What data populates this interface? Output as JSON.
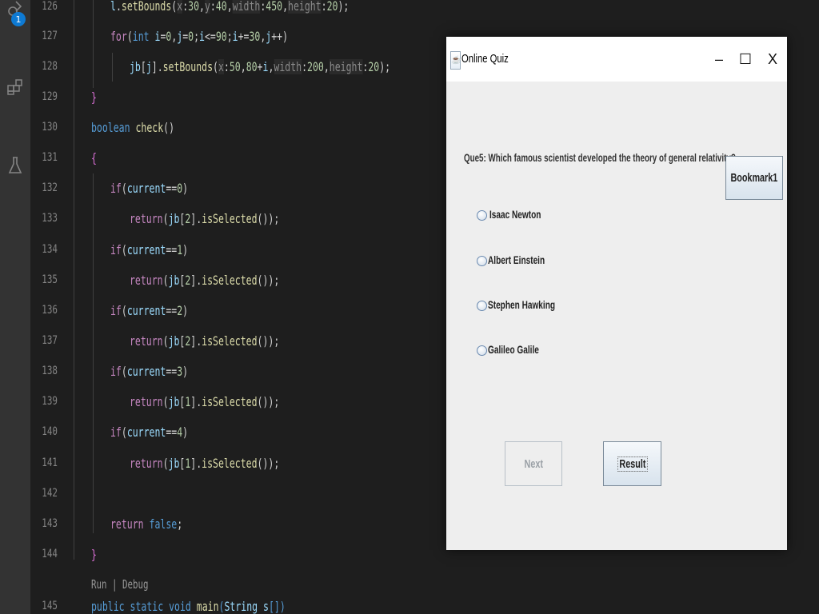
{
  "activity_bar": {
    "badge": "1"
  },
  "editor": {
    "lines": [
      {
        "num": "126",
        "text": "l.setBounds(x:30,y:40,width:450,height:20);"
      },
      {
        "num": "127",
        "text": "for(int i=0,j=0;i<=90;i+=30,j++)"
      },
      {
        "num": "128",
        "text": "jb[j].setBounds(x:50,80+i,width:200,height:20);"
      },
      {
        "num": "129",
        "text": "}"
      },
      {
        "num": "130",
        "text": "boolean check()"
      },
      {
        "num": "131",
        "text": "{"
      },
      {
        "num": "132",
        "text": "if(current==0)"
      },
      {
        "num": "133",
        "text": "return(jb[2].isSelected());"
      },
      {
        "num": "134",
        "text": "if(current==1)"
      },
      {
        "num": "135",
        "text": "return(jb[2].isSelected());"
      },
      {
        "num": "136",
        "text": "if(current==2)"
      },
      {
        "num": "137",
        "text": "return(jb[2].isSelected());"
      },
      {
        "num": "138",
        "text": "if(current==3)"
      },
      {
        "num": "139",
        "text": "return(jb[1].isSelected());"
      },
      {
        "num": "140",
        "text": "if(current==4)"
      },
      {
        "num": "141",
        "text": "return(jb[1].isSelected());"
      },
      {
        "num": "142",
        "text": ""
      },
      {
        "num": "143",
        "text": "return false;"
      },
      {
        "num": "144",
        "text": "}"
      },
      {
        "num": "145",
        "text": "public static void main(String s[])"
      }
    ],
    "codelens": "Run | Debug"
  },
  "quiz_window": {
    "title": "Online Quiz",
    "minimize": "–",
    "maximize": "☐",
    "close": "X",
    "question": "Que5: Which famous scientist developed the theory of general relativity?",
    "options": [
      "Isaac Newton",
      "Albert Einstein",
      "Stephen Hawking",
      "Galileo Galile"
    ],
    "bookmark_label": "Bookmark1",
    "next_label": "Next",
    "result_label": "Result",
    "next_enabled": false
  }
}
